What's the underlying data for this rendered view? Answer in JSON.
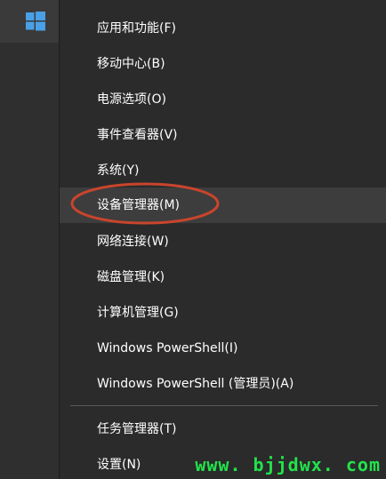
{
  "menu": {
    "items": [
      {
        "label": "应用和功能(F)"
      },
      {
        "label": "移动中心(B)"
      },
      {
        "label": "电源选项(O)"
      },
      {
        "label": "事件查看器(V)"
      },
      {
        "label": "系统(Y)"
      },
      {
        "label": "设备管理器(M)"
      },
      {
        "label": "网络连接(W)"
      },
      {
        "label": "磁盘管理(K)"
      },
      {
        "label": "计算机管理(G)"
      },
      {
        "label": "Windows PowerShell(I)"
      },
      {
        "label": "Windows PowerShell (管理员)(A)"
      },
      {
        "label": "任务管理器(T)"
      },
      {
        "label": "设置(N)"
      }
    ]
  },
  "watermark": {
    "text": "www. bjjdwx. com"
  },
  "colors": {
    "menu_bg": "#2b2b2b",
    "hover_bg": "#3d3d3d",
    "annotation": "#c8452c",
    "watermark": "#22e34b",
    "windows_logo": "#4aa0e6"
  },
  "icons": {
    "start": "windows-logo-icon"
  }
}
